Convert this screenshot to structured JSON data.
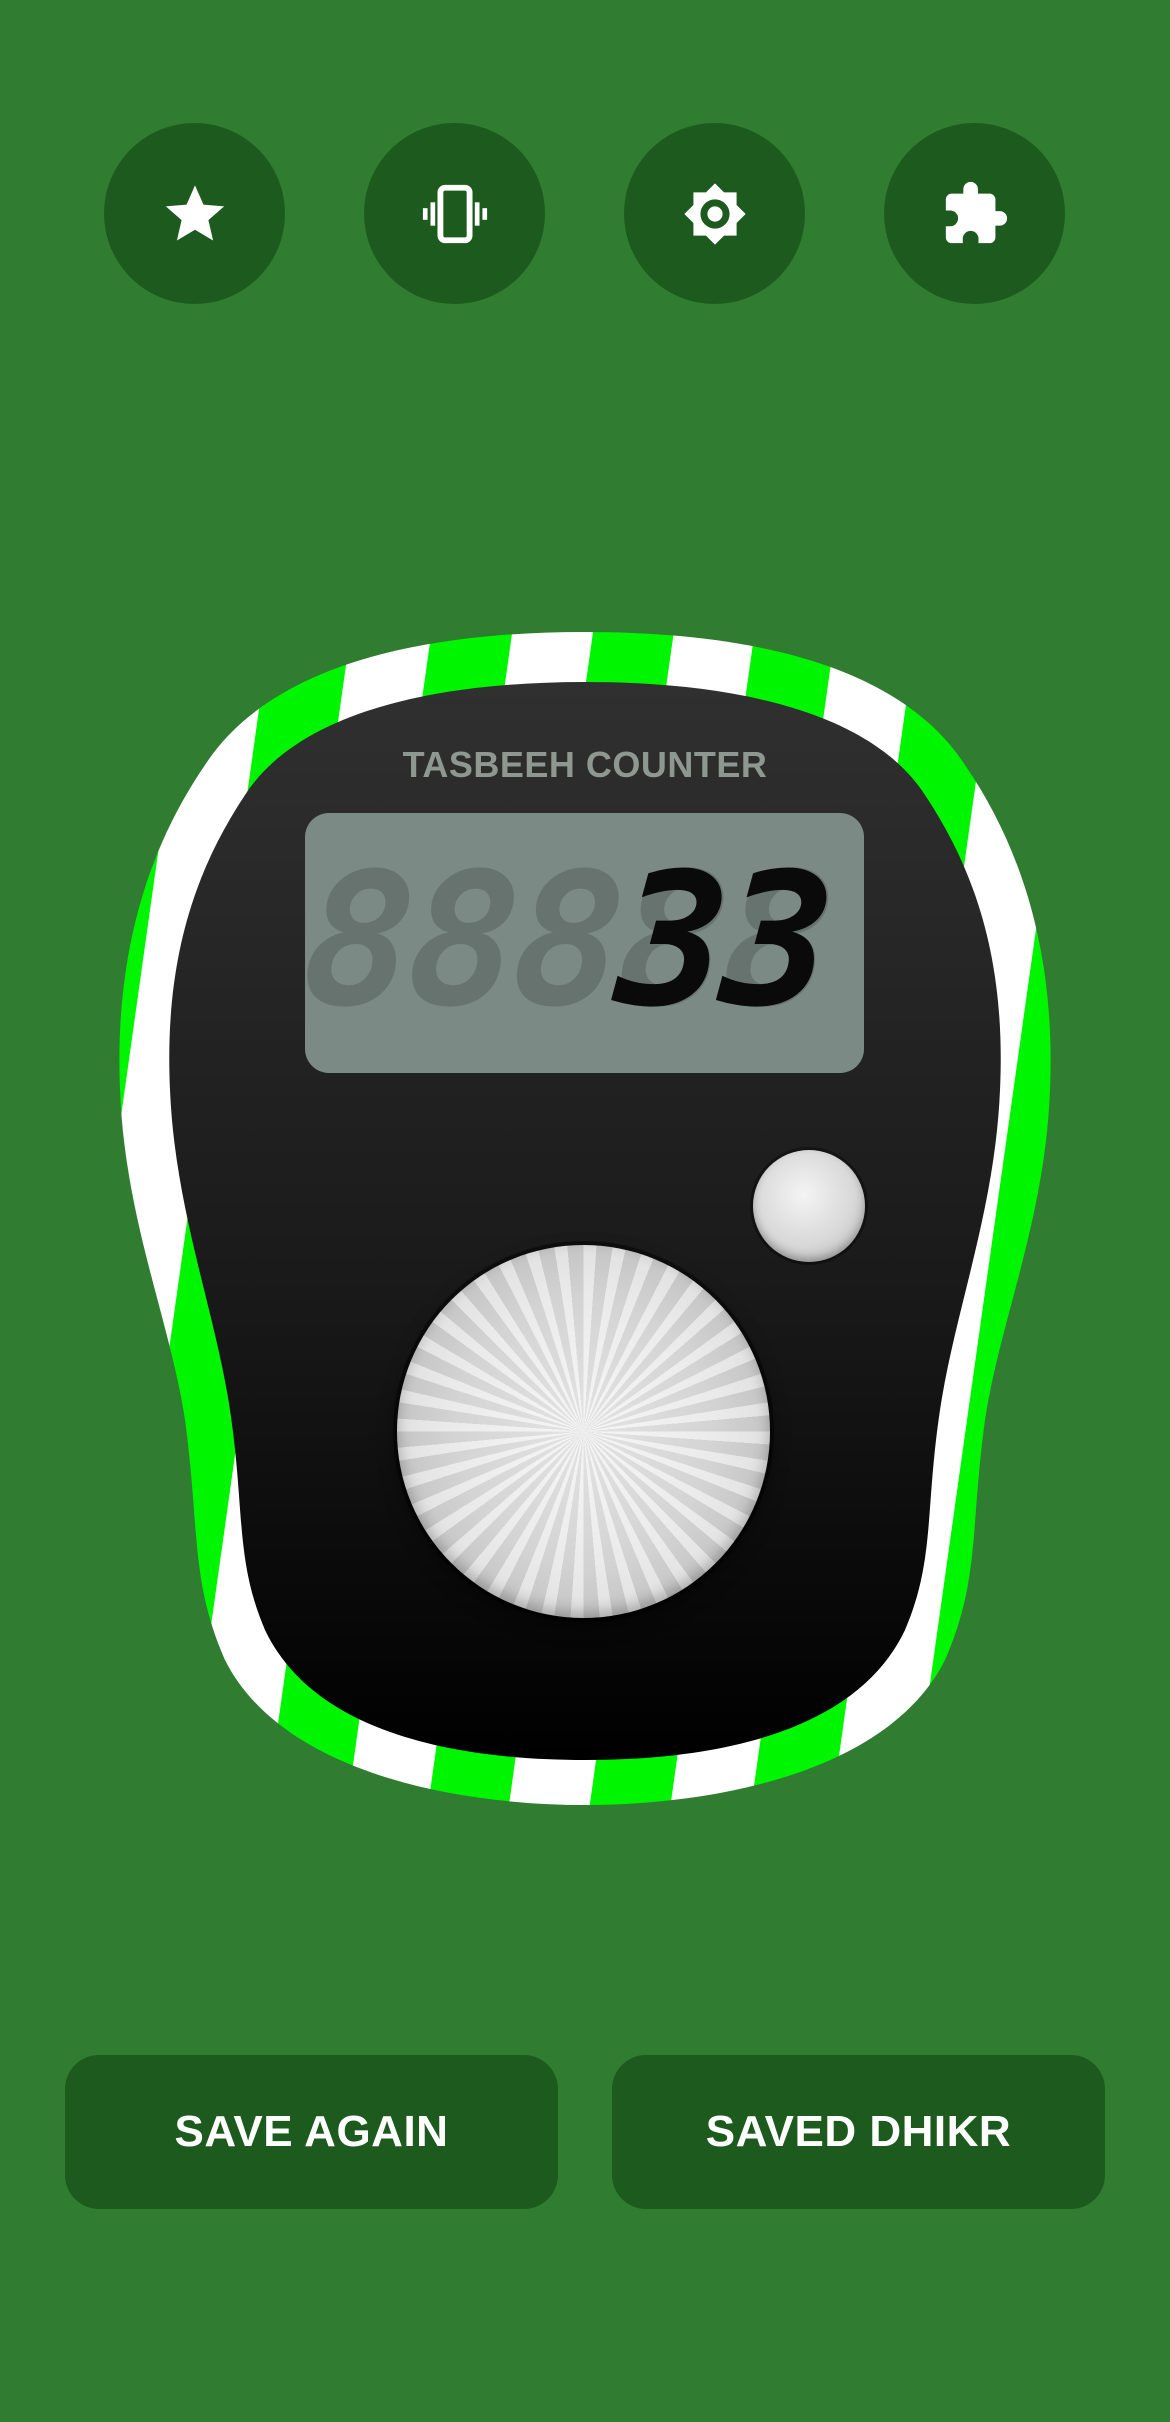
{
  "toolbar": {
    "icons": [
      "star-icon",
      "vibration-icon",
      "brightness-icon",
      "puzzle-icon"
    ]
  },
  "counter": {
    "title": "TASBEEH COUNTER",
    "display_value": "33",
    "ghost_digits": "88888"
  },
  "actions": {
    "save_again_label": "SAVE AGAIN",
    "saved_dhikr_label": "SAVED DHIKR"
  },
  "colors": {
    "background": "#307d32",
    "button": "#1c5a1e",
    "ring_green": "#00f500",
    "ring_white": "#ffffff",
    "device_body": "#1a1a1a",
    "lcd": "#7b8a85"
  }
}
